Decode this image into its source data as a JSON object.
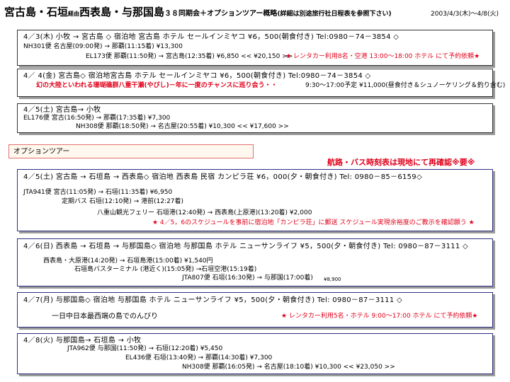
{
  "header": {
    "title_a": "宮古島・石垣",
    "title_b": "経由",
    "title_c": "西表島・与那国島",
    "title_d": "３８同期会＋オプションツアー概略",
    "title_note": "(詳細は別途旅行社日程表を参照下さい)",
    "date_range": "2003/4/3(木)～4/8(火)"
  },
  "main_days": [
    {
      "line1": "4／3(木) 小牧 → 宮古島 ◇ 宿泊地  宮古島  ホテル  セールインミヤコ   ¥6，500(朝食付き)  Tel:0980－74－3854  ◇",
      "line2": "NH301便 名古屋(09:00発) → 那覇(11:15着) ¥13,300",
      "line3": "EL173便  那覇(11:50発) → 宮古島(12:35着) ¥6,850  << ¥20,150 >>",
      "line3_note": "★ レンタカー利用8名・空港 13:00～18:00 ホテル にて予約依頼★"
    },
    {
      "line1": "4／ 4(金) 宮古島◇ 宿泊地宮古島  ホテル  セールインミヤコ   ¥6，500(朝食付き)  Tel:0980－74－3854 ◇",
      "line2_red": "幻の大陸といわれる珊瑚礁群八重干瀬(やびし)－年に一度のチャンスに巡り会う・・",
      "line2_black": "9:30～17:00予定 ¥11,000(昼食付き＆シュノーケリング＆釣り含む)"
    },
    {
      "line1": "4／5(土) 宮古島→ 小牧",
      "line2": "EL176便 宮古(16:50発) → 那覇(17:35着) ¥7,300",
      "line3": "NH308便 那覇(18:50発) → 名古屋(20:55着) ¥10,300  << ¥17,600 >>"
    }
  ],
  "option_tour": {
    "label": "オプションツアー",
    "alert": "航路・バス時刻表は現地にて再確認※要※",
    "days": [
      {
        "line1": "4／5(土) 宮古島 → 石垣島 → 西表島◇ 宿泊地  西表島  民宿  カンピラ荘  ¥6，000(夕・朝食付き)  Tel: 0980－85－6159◇",
        "line2": "JTA941便 宮古(11:05発) → 石垣(11:35着) ¥6,950",
        "line3": "定期バス 石垣(12:10発) → 港前(12:27着)",
        "line4": "八重山観光フェリー  石垣港(12:40発) → 西表島(上原港)(13:20着) ¥2,000",
        "line5": "★ 4／5，6のスケジュールを事前に宿泊地「カンピラ荘」に郵送  スケジュール実現余裕度のご教示を確認願う ★"
      },
      {
        "line1": "4／6(日) 西表島 → 石垣島 → 与那国島◇ 宿泊地  与那国島  ホテル  ニューサンライフ   ¥5，500(夕・朝食付き)  Tel: 0980－87－3111 ◇",
        "line2": "西表島・大原港(14:20発) → 石垣島港(15:00着) ¥1,540円",
        "line3": "石垣島バスターミナル (港近く)(15:05発) →石垣空港(15:19着)",
        "line4": "JTA807便 石垣(16:30発) → 与那国(17:00着)",
        "line4_price": "¥8,900"
      },
      {
        "line1": "4／7(月) 与那国島◇ 宿泊地  与那国島  ホテル  ニューサンライフ   ¥5，500(夕・朝食付き)  Tel: 0980－87－3111 ◇",
        "line2": "一日中日本最西端の島でのんびり",
        "line2_note": "★ レンタカー利用5名・ホテル 9:00～17:00 ホテル  にて予約依頼★"
      },
      {
        "line1": "4／8(火) 与那国島→ 石垣島 → 小牧",
        "line2": "JTA962便 与那国(11:50発) → 石垣(12:20着) ¥5,450",
        "line3": "EL436便  石垣(13:40発) → 那覇(14:30着) ¥7,300",
        "line4": "NH308便 那覇(16:05発) → 名古屋(18:10着) ¥10,300  << ¥23,050 >>"
      }
    ]
  }
}
